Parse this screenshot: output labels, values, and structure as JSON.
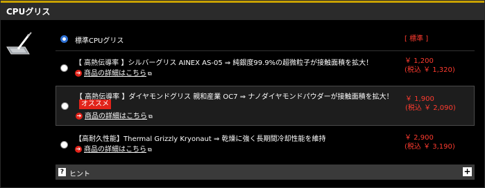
{
  "section": {
    "title": "CPUグリス"
  },
  "options": [
    {
      "label": "標準CPUグリス",
      "checked": true,
      "price": "[ 標準 ]",
      "price_incl": ""
    },
    {
      "label": "【 高熱伝導率 】シルバーグリス AINEX AS-05 ⇒ 純銀度99.9%の超微粒子が接触面積を拡大！",
      "detail": "商品の詳細はこちら",
      "price": "￥ 1,200",
      "price_incl": "(税込 ￥ 1,320)"
    },
    {
      "label": "【 高熱伝導率 】ダイヤモンドグリス 親和産業 OC7 ⇒ ナノダイヤモンドパウダーが接触面積を拡大！",
      "badge": "オススメ",
      "detail": "商品の詳細はこちら",
      "price": "￥ 1,900",
      "price_incl": "(税込 ￥ 2,090)"
    },
    {
      "label": "【高耐久性能】Thermal Grizzly Kryonaut ⇒ 乾燥に強く長期間冷却性能を維持",
      "detail": "商品の詳細はこちら",
      "price": "￥ 2,900",
      "price_incl": "(税込 ￥ 3,190)"
    }
  ],
  "hint": {
    "q": "?",
    "label": "ヒント",
    "plus": "+"
  },
  "icons": {
    "arrow": "arrow-circle-icon",
    "external": "external-link-icon",
    "cpu": "grease-applicator-icon"
  },
  "colors": {
    "accent": "#c8a200",
    "price": "#ff3b2f",
    "badge": "#e2231a",
    "radio_checked": "#2d6fd1"
  }
}
